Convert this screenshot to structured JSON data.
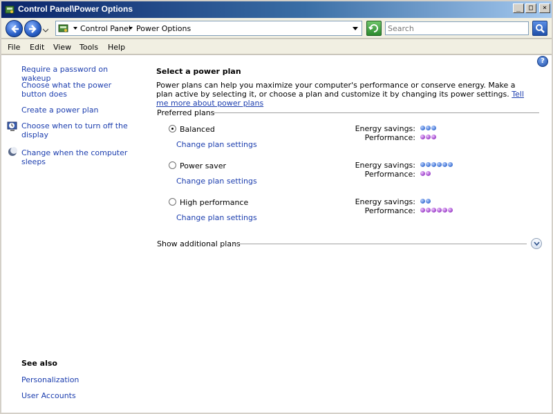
{
  "window": {
    "title": "Control Panel\\Power Options"
  },
  "navigation": {
    "breadcrumbs": [
      "Control Panel",
      "Power Options"
    ],
    "search_placeholder": "Search"
  },
  "menu": [
    "File",
    "Edit",
    "View",
    "Tools",
    "Help"
  ],
  "tasks": [
    "Require a password on wakeup",
    "Choose what the power button does",
    "Create a power plan",
    "Choose when to turn off the display",
    "Change when the computer sleeps"
  ],
  "see_also": {
    "title": "See also",
    "links": [
      "Personalization",
      "User Accounts"
    ]
  },
  "main": {
    "heading": "Select a power plan",
    "description": "Power plans can help you maximize your computer's performance or conserve energy. Make a plan active by selecting it, or choose a plan and customize it by changing its power settings.",
    "description_link": "Tell me more about power plans",
    "preferred_label": "Preferred plans",
    "additional_label": "Show additional plans",
    "energy_label": "Energy savings:",
    "performance_label": "Performance:",
    "plan_link_label": "Change plan settings",
    "plans": [
      {
        "name": "Balanced",
        "selected": true,
        "energy_savings": 3,
        "performance": 3
      },
      {
        "name": "Power saver",
        "selected": false,
        "energy_savings": 6,
        "performance": 2
      },
      {
        "name": "High performance",
        "selected": false,
        "energy_savings": 2,
        "performance": 6
      }
    ]
  },
  "colors": {
    "link": "#1b3dae",
    "energy_dot": "#3b6fd1",
    "performance_dot": "#9a3ec7"
  }
}
